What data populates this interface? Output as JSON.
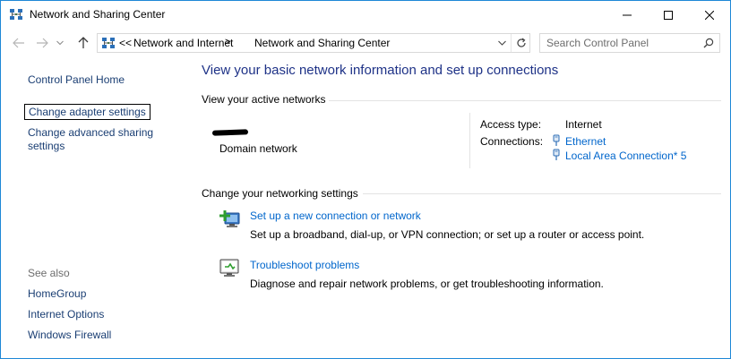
{
  "window": {
    "title": "Network and Sharing Center",
    "icon": "network-center-icon",
    "controls": [
      "minimize-icon",
      "maximize-icon",
      "close-icon"
    ]
  },
  "address_bar": {
    "overflow": "<<",
    "breadcrumbs": [
      "Network and Internet",
      "Network and Sharing Center"
    ],
    "separator": ">",
    "search_placeholder": "Search Control Panel"
  },
  "left_pane": {
    "links": [
      "Control Panel Home",
      "Change adapter settings",
      "Change advanced sharing settings"
    ],
    "see_also_title": "See also",
    "see_also": [
      "HomeGroup",
      "Internet Options",
      "Windows Firewall"
    ]
  },
  "main": {
    "heading": "View your basic network information and set up connections",
    "active_networks": {
      "title": "View your active networks",
      "network_type": "Domain network",
      "access_type_label": "Access type:",
      "access_type_value": "Internet",
      "connections_label": "Connections:",
      "connections": [
        "Ethernet",
        "Local Area Connection* 5"
      ]
    },
    "settings": {
      "title": "Change your networking settings",
      "tasks": [
        {
          "label": "Set up a new connection or network",
          "description": "Set up a broadband, dial-up, or VPN connection; or set up a router or access point.",
          "icon": "new-connection-icon"
        },
        {
          "label": "Troubleshoot problems",
          "description": "Diagnose and repair network problems, or get troubleshooting information.",
          "icon": "troubleshoot-icon"
        }
      ]
    }
  },
  "colors": {
    "window_border": "#1e87d6",
    "heading": "#1e3287",
    "link": "#0066cc",
    "nav_link": "#1a3e73",
    "muted": "#6d6d6d"
  }
}
